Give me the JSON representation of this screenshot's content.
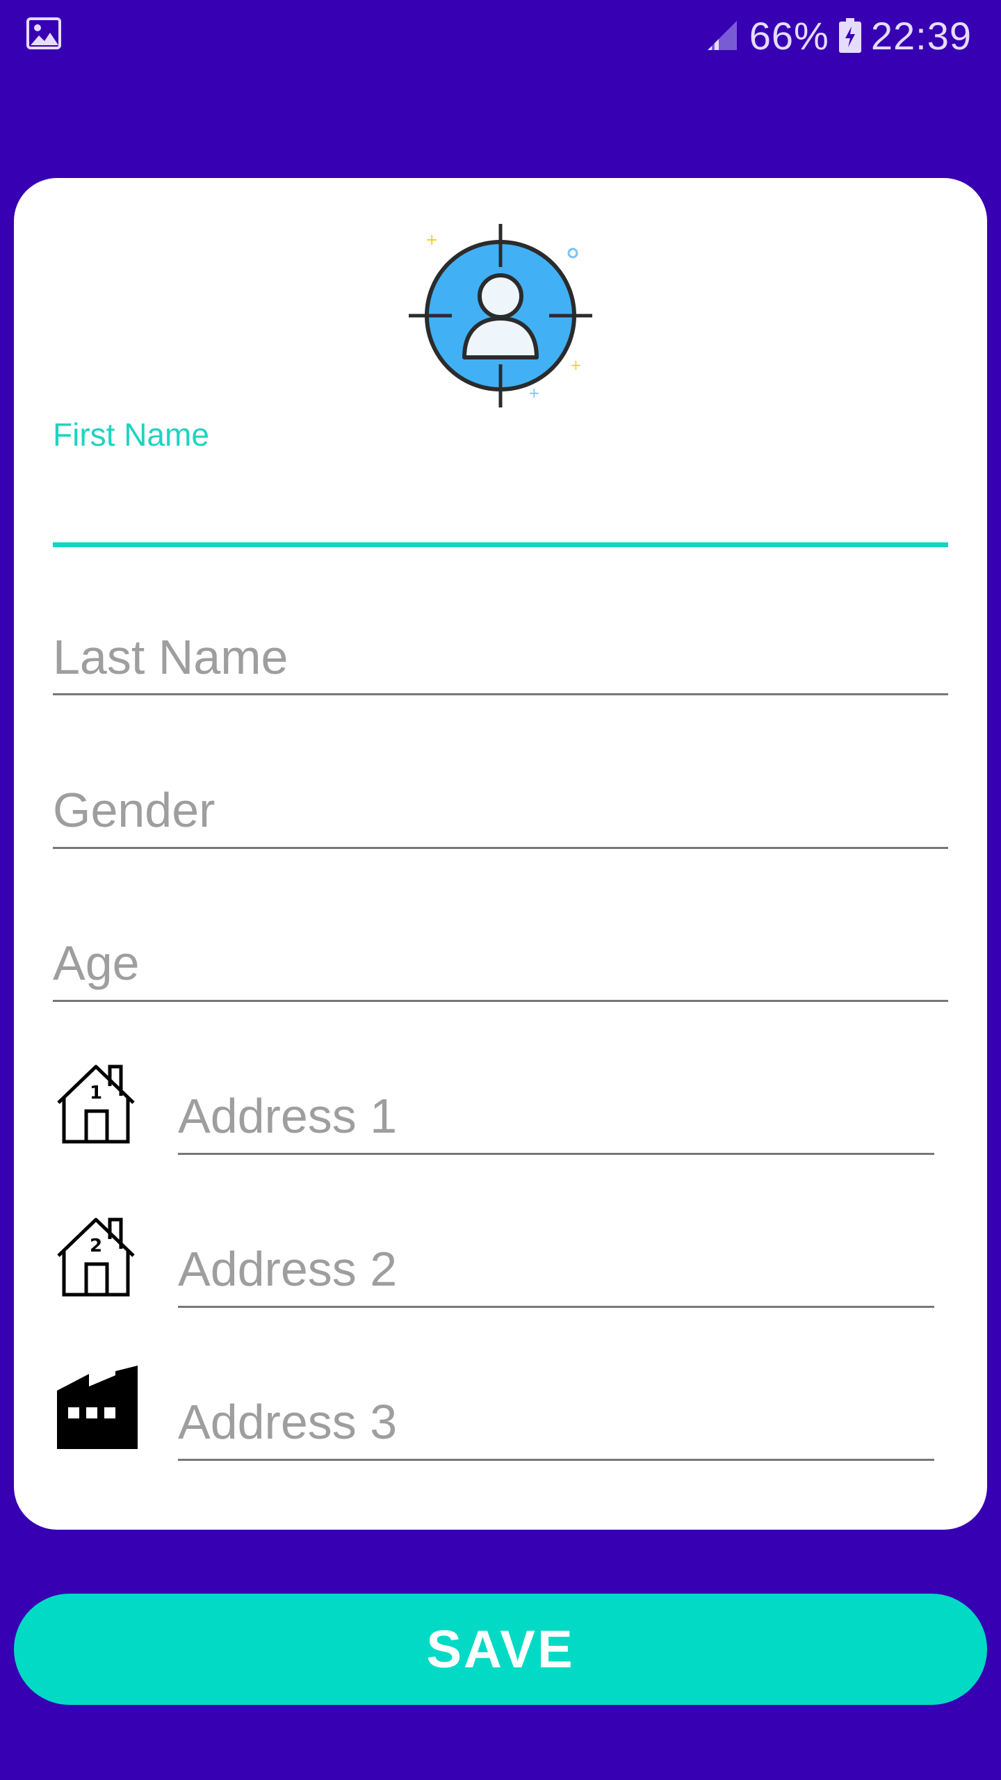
{
  "status_bar": {
    "left_icon": "image-icon",
    "battery_percent": "66%",
    "time": "22:39"
  },
  "avatar": {
    "icon": "user-target-icon"
  },
  "fields": {
    "first_name": {
      "label": "First Name",
      "value": ""
    },
    "last_name": {
      "placeholder": "Last Name"
    },
    "gender": {
      "placeholder": "Gender"
    },
    "age": {
      "placeholder": "Age"
    },
    "address1": {
      "placeholder": "Address 1",
      "icon": "house-1-icon"
    },
    "address2": {
      "placeholder": "Address 2",
      "icon": "house-2-icon"
    },
    "address3": {
      "placeholder": "Address 3",
      "icon": "factory-icon"
    }
  },
  "save_button": {
    "label": "SAVE"
  },
  "colors": {
    "background": "#3700b3",
    "accent": "#03dac5",
    "card": "#ffffff"
  }
}
